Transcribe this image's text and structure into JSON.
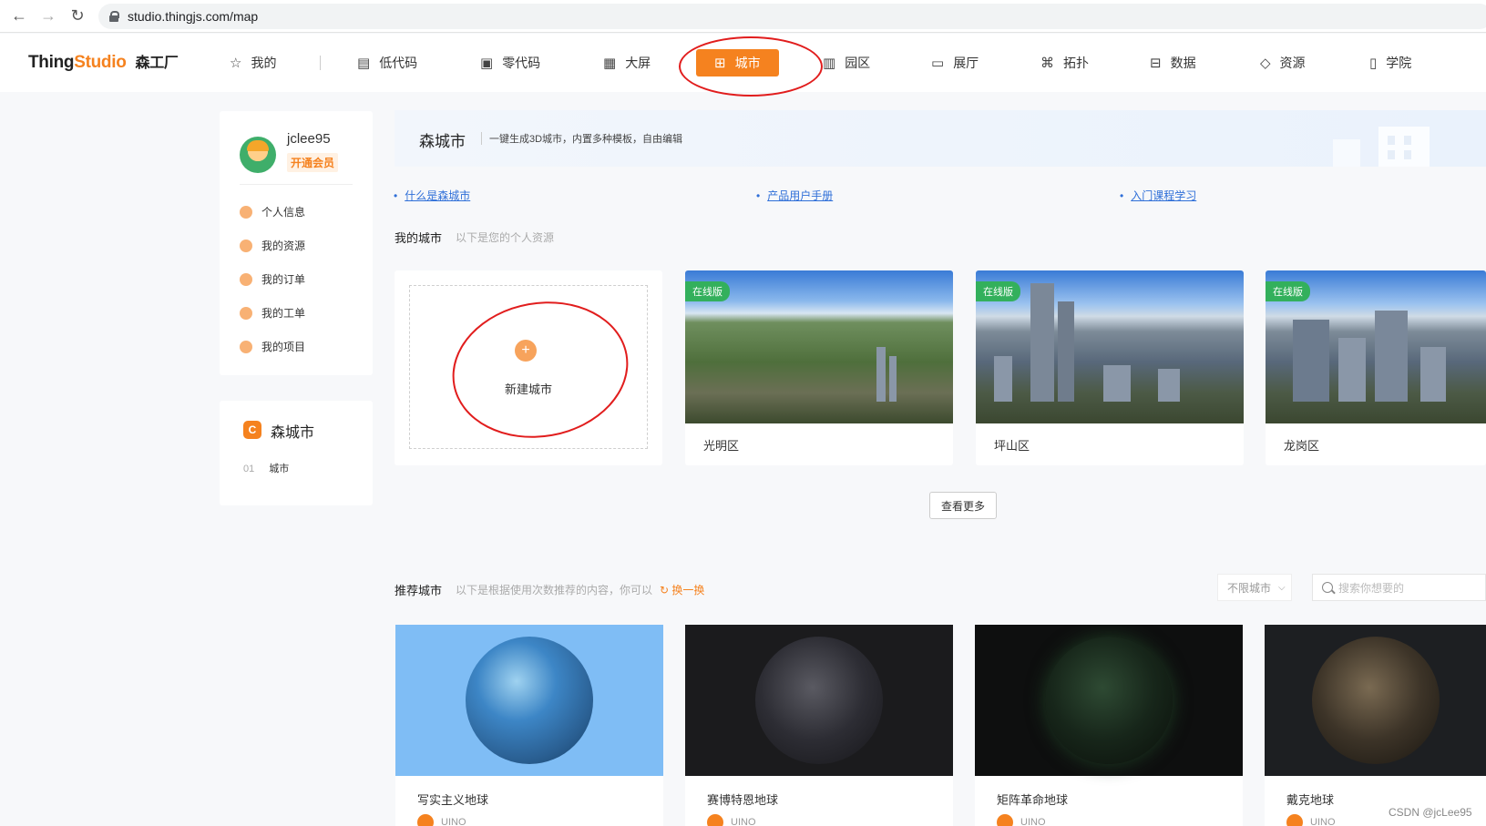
{
  "browser": {
    "url": "studio.thingjs.com/map"
  },
  "header": {
    "logo_thing": "Thing",
    "logo_studio": "Studio",
    "logo_cn": "森工厂",
    "nav": [
      {
        "label": "我的",
        "icon": "star-icon"
      },
      {
        "label": "低代码",
        "icon": "code-icon"
      },
      {
        "label": "零代码",
        "icon": "window-icon"
      },
      {
        "label": "大屏",
        "icon": "screen-icon"
      },
      {
        "label": "城市",
        "icon": "city-icon",
        "active": true
      },
      {
        "label": "园区",
        "icon": "park-icon"
      },
      {
        "label": "展厅",
        "icon": "hall-icon"
      },
      {
        "label": "拓扑",
        "icon": "topology-icon"
      },
      {
        "label": "数据",
        "icon": "data-icon"
      },
      {
        "label": "资源",
        "icon": "diamond-icon"
      },
      {
        "label": "学院",
        "icon": "book-icon"
      }
    ]
  },
  "profile": {
    "username": "jclee95",
    "vip_label": "开通会员",
    "menu": [
      "个人信息",
      "我的资源",
      "我的订单",
      "我的工单",
      "我的项目"
    ]
  },
  "city_panel": {
    "title": "森城市",
    "items": [
      {
        "num": "01",
        "label": "城市"
      }
    ]
  },
  "banner": {
    "title": "森城市",
    "desc": "一键生成3D城市，内置多种模板，自由编辑"
  },
  "links": [
    "什么是森城市",
    "产品用户手册",
    "入门课程学习"
  ],
  "my_cities": {
    "title": "我的城市",
    "subtitle": "以下是您的个人资源",
    "new_label": "新建城市",
    "badge": "在线版",
    "items": [
      "光明区",
      "坪山区",
      "龙岗区"
    ],
    "more_label": "查看更多"
  },
  "recommend": {
    "title": "推荐城市",
    "subtitle": "以下是根据使用次数推荐的内容，你可以",
    "refresh_label": "换一换",
    "filter_value": "不限城市",
    "search_placeholder": "搜索你想要的",
    "items": [
      {
        "name": "写实主义地球",
        "author": "UINO"
      },
      {
        "name": "赛博特恩地球",
        "author": "UINO"
      },
      {
        "name": "矩阵革命地球",
        "author": "UINO"
      },
      {
        "name": "戴克地球",
        "author": "UINO"
      }
    ]
  },
  "watermark": "CSDN @jcLee95",
  "colors": {
    "accent": "#f5821f",
    "online": "#33b05c",
    "link": "#2f6fd8",
    "annotation": "#e11d1d"
  }
}
